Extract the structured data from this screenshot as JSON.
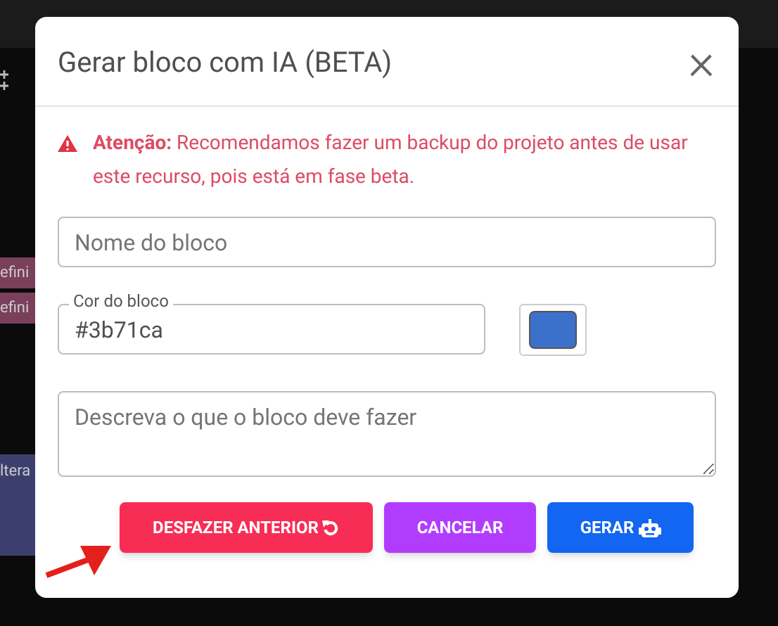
{
  "canvas_blocks": [
    {
      "label": "efini",
      "color": "#7a3f5a"
    },
    {
      "label": "efini",
      "color": "#7a3f5a"
    },
    {
      "label": "ltera",
      "color": "#3c3f6e"
    }
  ],
  "dialog": {
    "title": "Gerar bloco com IA (BETA)",
    "close": "×",
    "warning": "**Atenção:** Recomendamos fazer um backup do projeto antes de usar este recurso, pois está em fase beta.",
    "name_field": {
      "placeholder": "Nome do bloco"
    },
    "color_field": {
      "label": "Cor do bloco",
      "value": "#3b71ca",
      "color": "#3b71ca"
    },
    "description_field": {
      "placeholder": "Descreva o que o bloco deve fazer"
    },
    "buttons": [
      {
        "label": "DESFAZER ANTERIOR",
        "kind": "undo"
      },
      {
        "label": "CANCELAR",
        "kind": "cancel"
      },
      {
        "label": "GERAR",
        "kind": "generate"
      }
    ]
  }
}
